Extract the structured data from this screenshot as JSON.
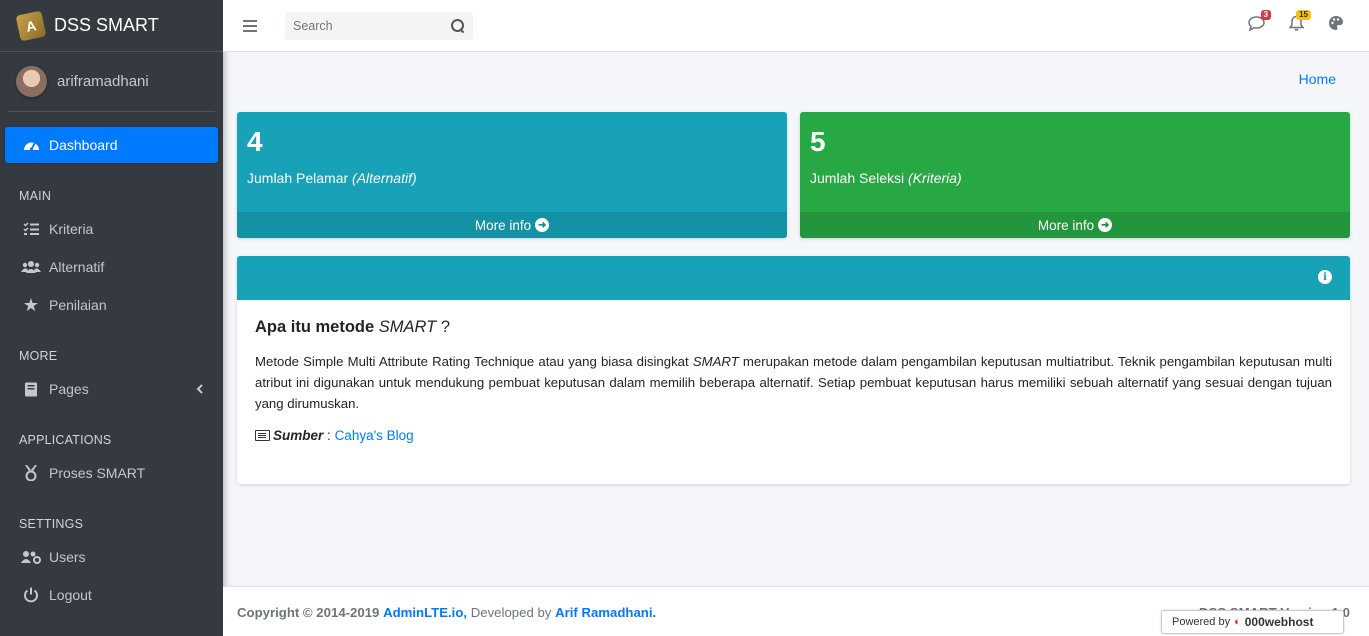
{
  "brand": {
    "title": "DSS SMART",
    "logo_letter": "A"
  },
  "user": {
    "name": "ariframadhani"
  },
  "sidebar": {
    "dashboard": "Dashboard",
    "main_header": "MAIN",
    "main_items": [
      "Kriteria",
      "Alternatif",
      "Penilaian"
    ],
    "more_header": "MORE",
    "pages": "Pages",
    "apps_header": "APPLICATIONS",
    "proses": "Proses SMART",
    "settings_header": "SETTINGS",
    "users": "Users",
    "logout": "Logout"
  },
  "topbar": {
    "search_placeholder": "Search",
    "messages_count": "3",
    "notifications_count": "15"
  },
  "breadcrumb": "Home",
  "stats": [
    {
      "value": "4",
      "label": "Jumlah Pelamar",
      "label_em": "(Alternatif)",
      "more": "More info",
      "color": "#17a2b8"
    },
    {
      "value": "5",
      "label": "Jumlah Seleksi",
      "label_em": "(Kriteria)",
      "more": "More info",
      "color": "#28a745"
    }
  ],
  "card": {
    "title_prefix": "Apa itu metode",
    "title_em": "SMART",
    "title_suffix": "?",
    "text_1": "Metode Simple Multi Attribute Rating Technique atau yang biasa disingkat",
    "text_em": "SMART",
    "text_2": "merupakan metode dalam pengambilan keputusan multiatribut. Teknik pengambilan keputusan multi atribut ini digunakan untuk mendukung pembuat keputusan dalam memilih beberapa alternatif. Setiap pembuat keputusan harus memiliki sebuah alternatif yang sesuai dengan tujuan yang dirumuskan.",
    "source_label": "Sumber",
    "source_sep": ":",
    "source_link": "Cahya's Blog"
  },
  "footer": {
    "copyright": "Copyright © 2014-2019",
    "adminlte": "AdminLTE.io,",
    "developed": "Developed by",
    "author": "Arif Ramadhani.",
    "version": "DSS SMART Version 1.0"
  },
  "powered": {
    "label": "Powered by",
    "host": "000webhost"
  }
}
